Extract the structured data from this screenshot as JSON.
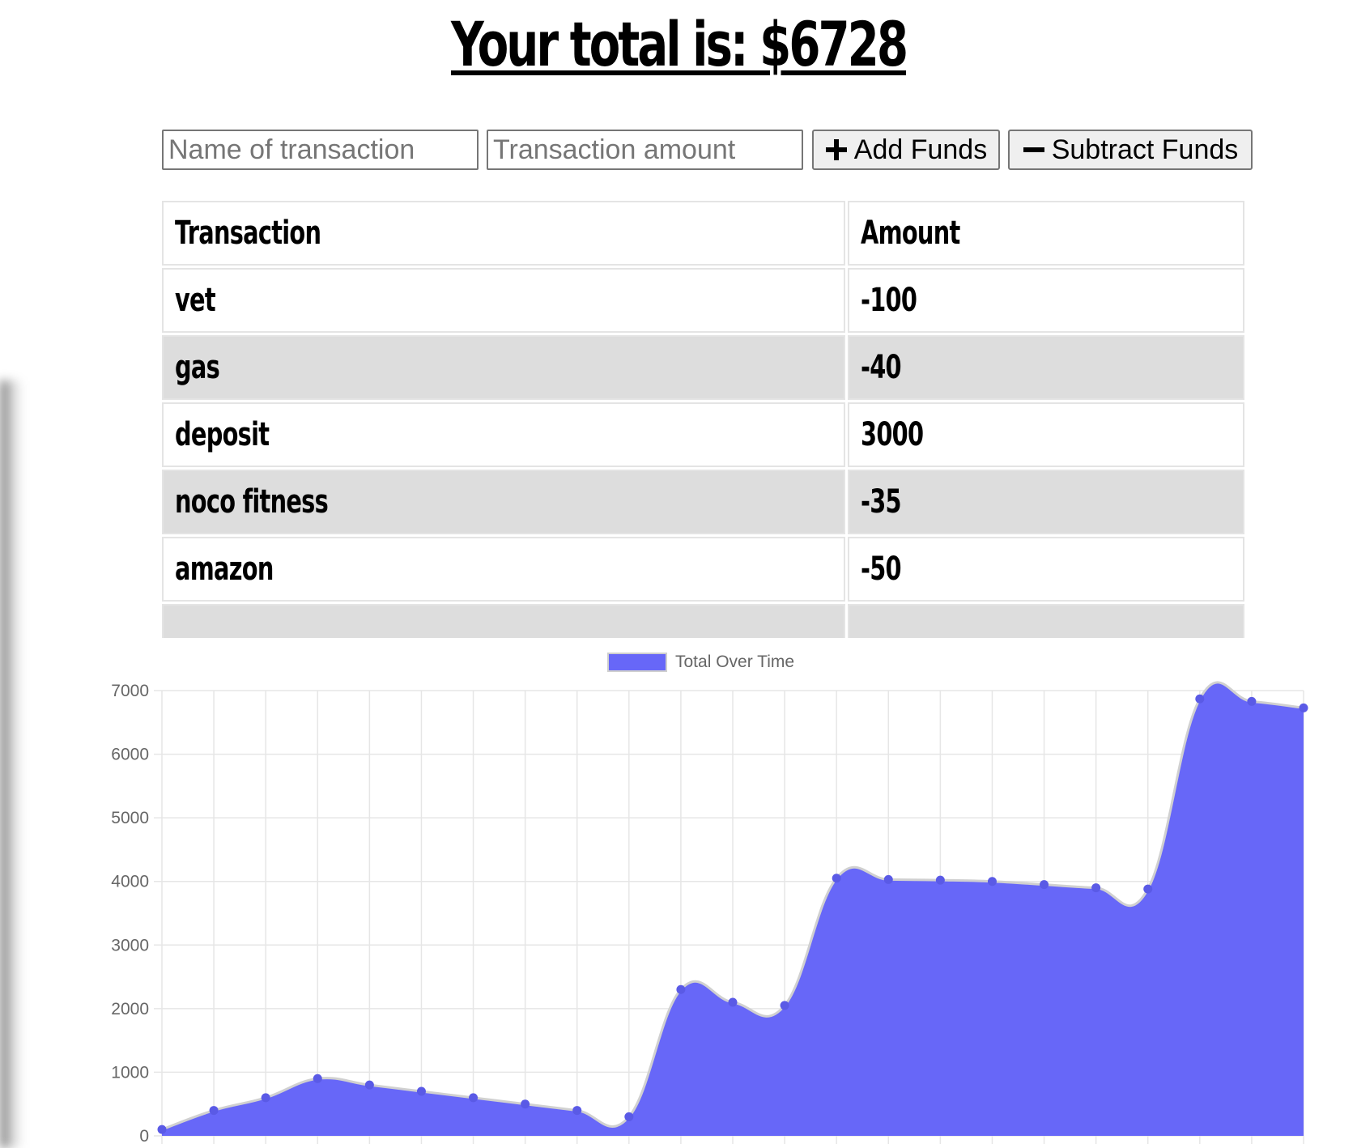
{
  "header": {
    "total_text": "Your total is: $6728"
  },
  "form": {
    "name_placeholder": "Name of transaction",
    "amount_placeholder": "Transaction amount",
    "add_label": "Add Funds",
    "subtract_label": "Subtract Funds"
  },
  "table": {
    "headers": [
      "Transaction",
      "Amount"
    ],
    "rows": [
      {
        "name": "vet",
        "amount": "-100"
      },
      {
        "name": "gas",
        "amount": "-40"
      },
      {
        "name": "deposit",
        "amount": "3000"
      },
      {
        "name": "noco fitness",
        "amount": "-35"
      },
      {
        "name": "amazon",
        "amount": "-50"
      }
    ]
  },
  "colors": {
    "series_fill": "#6767f8",
    "series_line": "#5a5ae6",
    "grid": "#e6e6e6",
    "tick_text": "#666666"
  },
  "chart_data": {
    "type": "area",
    "legend": "Total Over Time",
    "legend_position": "top-center",
    "grid": true,
    "ylim": [
      0,
      7000
    ],
    "yticks": [
      "0",
      "1000",
      "2000",
      "3000",
      "4000",
      "5000",
      "6000",
      "7000"
    ],
    "x_tick_label": "21",
    "series": [
      {
        "name": "Total Over Time",
        "values": [
          100,
          400,
          600,
          900,
          800,
          700,
          600,
          500,
          400,
          300,
          2300,
          2100,
          2050,
          4050,
          4030,
          4020,
          4000,
          3950,
          3900,
          3880,
          6870,
          6830,
          6728
        ]
      }
    ]
  }
}
